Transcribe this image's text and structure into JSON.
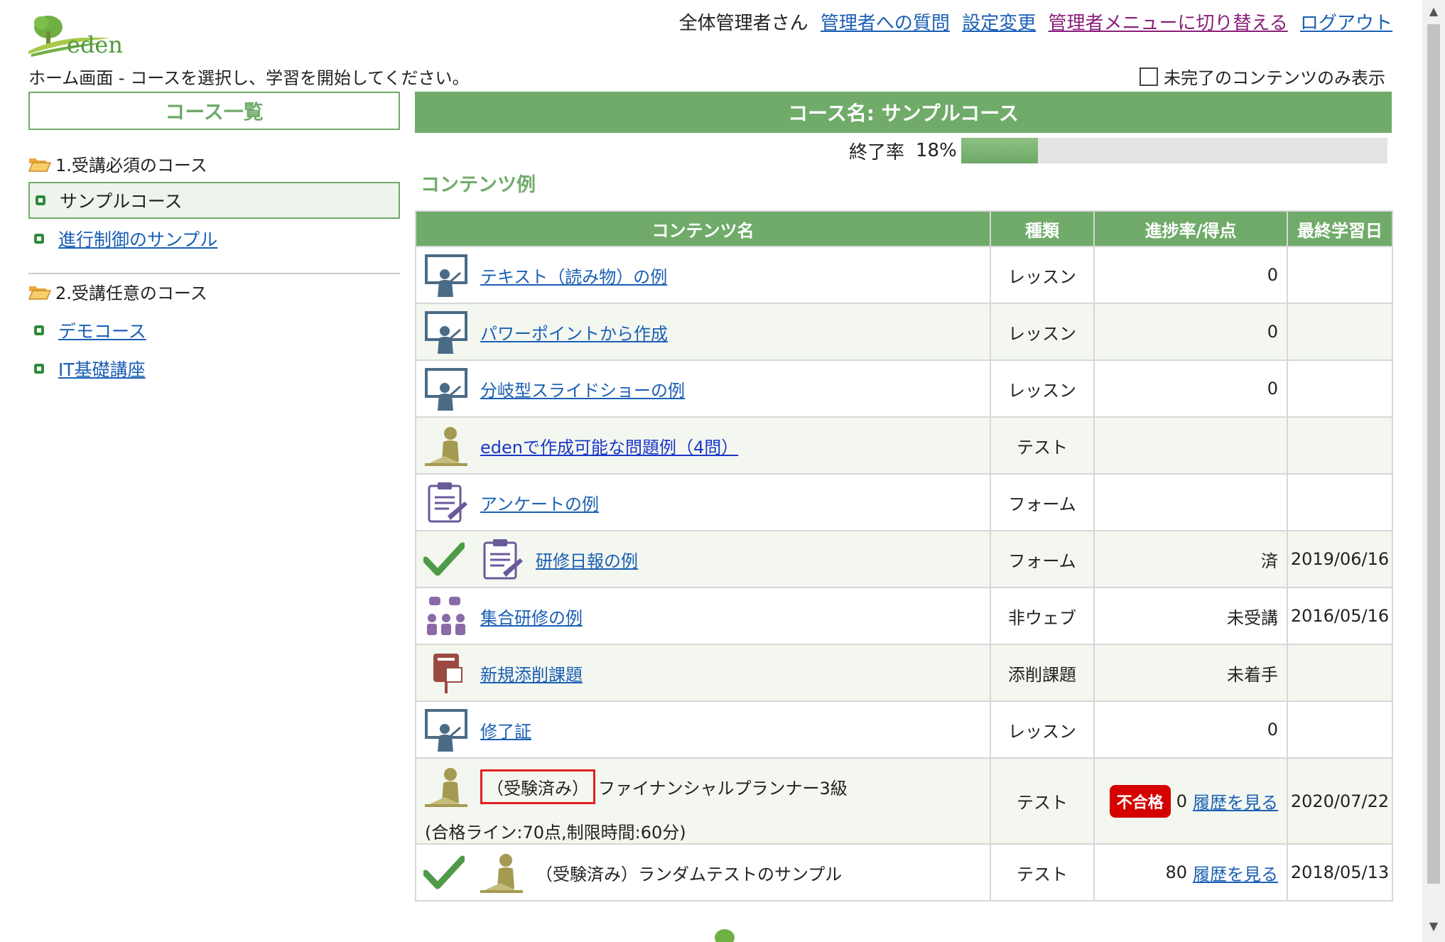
{
  "header": {
    "user_label": "全体管理者さん",
    "links": {
      "question": "管理者への質問",
      "settings": "設定変更",
      "switch_menu": "管理者メニューに切り替える",
      "logout": "ログアウト"
    },
    "breadcrumb": "ホーム画面 - コースを選択し、学習を開始してください。",
    "filter_label": "未完了のコンテンツのみ表示",
    "logo_text": "eden"
  },
  "left": {
    "title": "コース一覧",
    "categories": [
      {
        "label": "1.受講必須のコース",
        "courses": [
          "サンプルコース",
          "進行制御のサンプル"
        ]
      },
      {
        "label": "2.受講任意のコース",
        "courses": [
          "デモコース",
          "IT基礎講座"
        ]
      }
    ]
  },
  "main": {
    "course_title": "コース名: サンプルコース",
    "completion_label": "終了率",
    "completion_percent_text": "18%",
    "completion_fraction": 0.18,
    "section_title": "コンテンツ例",
    "columns": [
      "コンテンツ名",
      "種類",
      "進捗率/得点",
      "最終学習日"
    ],
    "rows": [
      {
        "name": "テキスト（読み物）の例",
        "type": "レッスン",
        "progress": "0",
        "date": ""
      },
      {
        "name": "パワーポイントから作成",
        "type": "レッスン",
        "progress": "0",
        "date": ""
      },
      {
        "name": "分岐型スライドショーの例",
        "type": "レッスン",
        "progress": "0",
        "date": ""
      },
      {
        "name": "edenで作成可能な問題例（4問）",
        "type": "テスト",
        "progress": "",
        "date": ""
      },
      {
        "name": "アンケートの例",
        "type": "フォーム",
        "progress": "",
        "date": ""
      },
      {
        "name": "研修日報の例",
        "type": "フォーム",
        "progress": "済",
        "date": "2019/06/16"
      },
      {
        "name": "集合研修の例",
        "type": "非ウェブ",
        "progress": "未受講",
        "date": "2016/05/16"
      },
      {
        "name": "新規添削課題",
        "type": "添削課題",
        "progress": "未着手",
        "date": ""
      },
      {
        "name": "修了証",
        "type": "レッスン",
        "progress": "0",
        "date": ""
      },
      {
        "taken_label": "（受験済み）",
        "name": "ファイナンシャルプランナー3級",
        "sub": "(合格ライン:70点,制限時間:60分)",
        "type": "テスト",
        "badge": "不合格",
        "score": "0",
        "history": "履歴を見る",
        "date": "2020/07/22"
      },
      {
        "taken_label": "（受験済み）",
        "name": "ランダムテストのサンプル",
        "type": "テスト",
        "score": "80",
        "history": "履歴を見る",
        "date": "2018/05/13"
      }
    ]
  },
  "colors": {
    "accent": "#70ab6a",
    "fail": "#d50000",
    "link": "#1a5fb4",
    "link_visited": "#8a1f7a"
  }
}
